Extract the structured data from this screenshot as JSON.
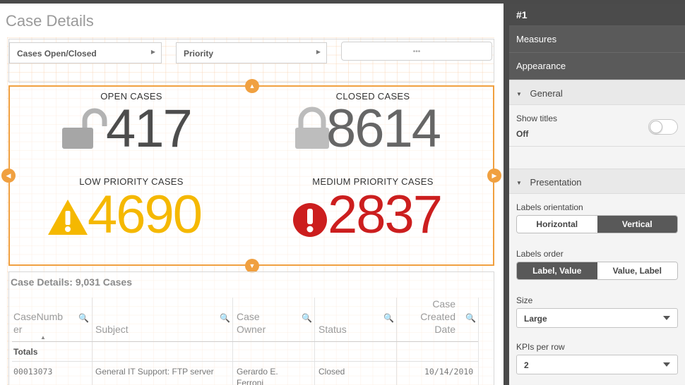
{
  "page": {
    "title": "Case Details"
  },
  "filters": [
    {
      "label": "Cases Open/Closed"
    },
    {
      "label": "Priority"
    },
    {
      "label": "•••"
    }
  ],
  "kpis": [
    {
      "label": "OPEN CASES",
      "value": "417",
      "icon": "unlocked-padlock-icon",
      "color": "#4d4d4d"
    },
    {
      "label": "CLOSED CASES",
      "value": "8614",
      "icon": "locked-padlock-icon",
      "color": "#666666"
    },
    {
      "label": "LOW PRIORITY CASES",
      "value": "4690",
      "icon": "warning-triangle-icon",
      "color": "#f5b800"
    },
    {
      "label": "MEDIUM PRIORITY CASES",
      "value": "2837",
      "icon": "exclamation-circle-icon",
      "color": "#cc1e1e"
    }
  ],
  "table": {
    "title": "Case Details: 9,031 Cases",
    "columns": [
      {
        "label": "CaseNumb er",
        "line1": "CaseNumb",
        "line2": "er"
      },
      {
        "label": "Subject"
      },
      {
        "label": "Case Owner",
        "line1": "Case",
        "line2": "Owner"
      },
      {
        "label": "Status"
      },
      {
        "label": "Case Created Date",
        "line1": "Case",
        "line2": "Created",
        "line3": "Date"
      }
    ],
    "totals_label": "Totals",
    "rows": [
      {
        "case_number": "00013073",
        "subject": "General IT Support: FTP server",
        "owner_line1": "Gerardo E.",
        "owner_line2": "Ferroni",
        "status": "Closed",
        "created": "10/14/2010"
      }
    ]
  },
  "panel": {
    "header": "#1",
    "sections": [
      "Measures",
      "Appearance"
    ],
    "general": {
      "title": "General",
      "show_titles_label": "Show titles",
      "show_titles_value": "Off"
    },
    "presentation": {
      "title": "Presentation",
      "labels_orientation_label": "Labels orientation",
      "orientation_options": [
        "Horizontal",
        "Vertical"
      ],
      "orientation_selected": "Vertical",
      "labels_order_label": "Labels order",
      "order_options": [
        "Label, Value",
        "Value, Label"
      ],
      "order_selected": "Label, Value",
      "size_label": "Size",
      "size_value": "Large",
      "kpis_per_row_label": "KPIs per row",
      "kpis_per_row_value": "2"
    }
  },
  "colors": {
    "accent": "#f0a040",
    "panel_dark": "#4b4b4b"
  }
}
